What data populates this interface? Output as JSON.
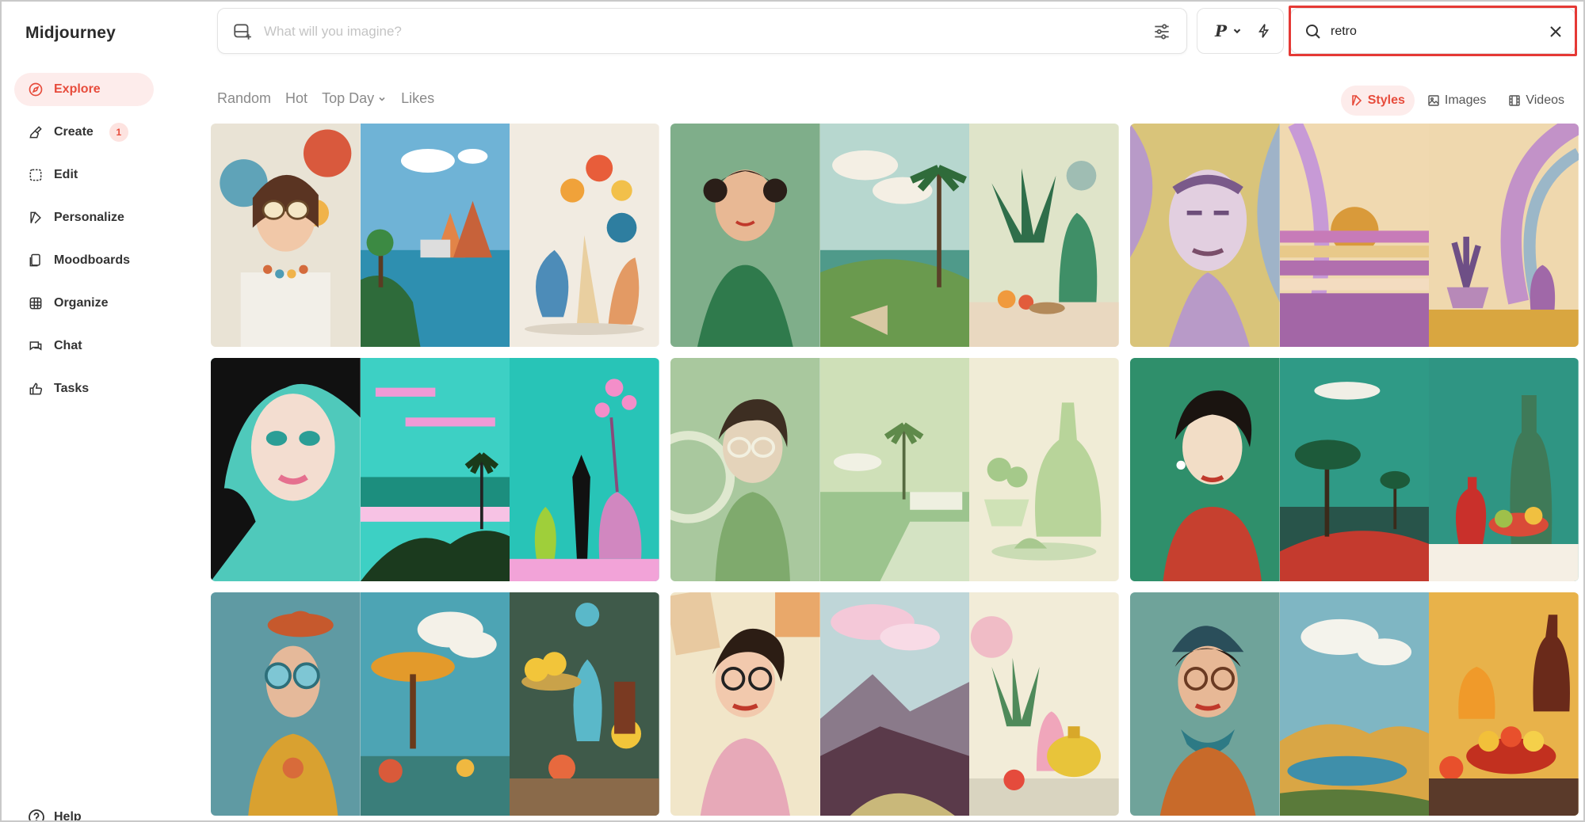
{
  "app": {
    "title": "Midjourney"
  },
  "sidebar": {
    "items": [
      {
        "label": "Explore",
        "icon": "compass-icon",
        "active": true
      },
      {
        "label": "Create",
        "icon": "brush-icon",
        "badge": "1"
      },
      {
        "label": "Edit",
        "icon": "edit-frame-icon"
      },
      {
        "label": "Personalize",
        "icon": "personalize-icon"
      },
      {
        "label": "Moodboards",
        "icon": "moodboard-icon"
      },
      {
        "label": "Organize",
        "icon": "grid-icon"
      },
      {
        "label": "Chat",
        "icon": "chat-icon"
      },
      {
        "label": "Tasks",
        "icon": "thumbs-up-icon"
      }
    ],
    "help_label": "Help"
  },
  "prompt": {
    "placeholder": "What will you imagine?"
  },
  "mode": {
    "label": "P"
  },
  "search": {
    "value": "retro"
  },
  "filters": {
    "random": "Random",
    "hot": "Hot",
    "top_day": "Top Day",
    "likes": "Likes"
  },
  "view_tabs": {
    "styles": "Styles",
    "images": "Images",
    "videos": "Videos",
    "active": "styles"
  },
  "colors": {
    "accent": "#e74c3c",
    "accent_bg": "#fdeceb",
    "highlight_border": "#e53935"
  },
  "gallery": {
    "cards": [
      {
        "tiles": [
          "retro-woman-sunglasses",
          "teal-lagoon-landscape",
          "vases-and-flowers"
        ]
      },
      {
        "tiles": [
          "green-pinup-woman",
          "tropical-palms-landscape",
          "green-teapot-still-life"
        ]
      },
      {
        "tiles": [
          "purple-abstract-face",
          "purple-striped-sunset",
          "purple-pastel-vases"
        ]
      },
      {
        "tiles": [
          "pop-art-woman-teal",
          "teal-pink-coast",
          "pink-blossom-bottles"
        ]
      },
      {
        "tiles": [
          "sage-woman-glasses",
          "sage-modern-house",
          "sage-glass-pitcher"
        ]
      },
      {
        "tiles": [
          "green-woman-red-sweater",
          "green-pine-landscape",
          "green-bottle-fruit"
        ]
      },
      {
        "tiles": [
          "teal-woman-orange-hat",
          "orange-tree-clouds",
          "lemons-turquoise-vase"
        ]
      },
      {
        "tiles": [
          "comic-woman-glasses",
          "pink-clouds-mountains",
          "pink-vase-teapot"
        ]
      },
      {
        "tiles": [
          "woman-scarf-glasses",
          "clouds-lake-hills",
          "orange-pitcher-fruit"
        ]
      }
    ]
  }
}
